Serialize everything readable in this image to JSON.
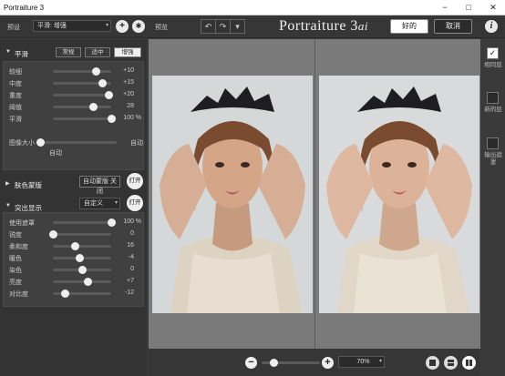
{
  "window": {
    "title": "Portraiture 3",
    "minimize": "−",
    "maximize": "□",
    "close": "✕"
  },
  "toolbar": {
    "preset_label": "预设",
    "preset_value": "平滑: 增强",
    "preview_label": "预览",
    "undo": "↶",
    "redo": "↷",
    "dropdown": "▾",
    "add_icon": "+",
    "settings_icon": "✱",
    "brand_main": "Portraiture 3",
    "brand_sub": "ai",
    "ok": "好的",
    "cancel": "取消",
    "info": "i"
  },
  "smoothing": {
    "title": "平滑",
    "modes": [
      "常规",
      "适中",
      "增强"
    ],
    "active_mode": "增强",
    "sliders": [
      {
        "label": "较细",
        "value": "+10",
        "level": 0.73
      },
      {
        "label": "中度",
        "value": "+15",
        "level": 0.85
      },
      {
        "label": "重度",
        "value": "+20",
        "level": 0.95
      },
      {
        "label": "阈值",
        "value": "28",
        "level": 0.69
      },
      {
        "label": "平滑",
        "value": "100",
        "level": 1.0,
        "unit": "%"
      }
    ],
    "image_size_label": "图像大小",
    "image_size_right": "自动",
    "image_size_bottom": "自动"
  },
  "skin_mask": {
    "title": "肤色蒙版",
    "button": "自动蒙版 关闭",
    "toggle": "打开"
  },
  "enhance": {
    "title": "突出显示",
    "dropdown": "自定义",
    "toggle": "打开",
    "sliders": [
      {
        "label": "使用遮罩",
        "value": "100",
        "level": 1.0,
        "unit": "%"
      },
      {
        "label": "锐度",
        "value": "0",
        "level": 0.0
      },
      {
        "label": "柔和度",
        "value": "16",
        "level": 0.38
      },
      {
        "label": "暖色",
        "value": "-4",
        "level": 0.45
      },
      {
        "label": "染色",
        "value": "0",
        "level": 0.5
      },
      {
        "label": "亮度",
        "value": "+7",
        "level": 0.6
      },
      {
        "label": "对比度",
        "value": "-12",
        "level": 0.2
      }
    ]
  },
  "right_panel": {
    "check": "✓",
    "items": [
      "相同层",
      "新的层",
      "输出遮罩"
    ]
  },
  "bottom": {
    "zoom_out": "−",
    "zoom_in": "+",
    "zoom_value": "70%",
    "zoom_arrow": "▾",
    "zoom_level": 0.2
  }
}
